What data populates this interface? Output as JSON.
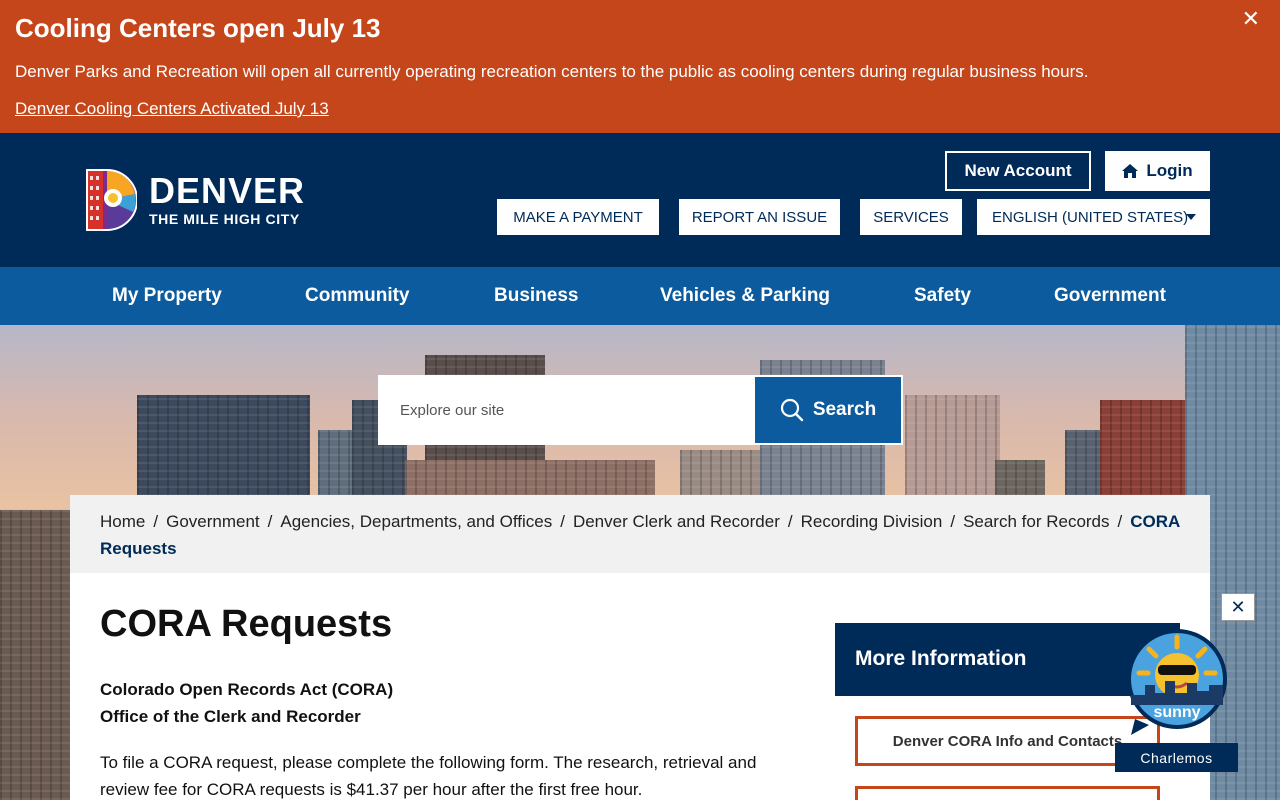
{
  "alert": {
    "title": "Cooling Centers open July 13",
    "text": "Denver Parks and Recreation will open all currently operating recreation centers to the public as cooling centers during regular business hours.",
    "link": "Denver Cooling Centers Activated July 13",
    "close": "✕"
  },
  "header": {
    "logo_big": "DENVER",
    "logo_small": "THE MILE HIGH CITY",
    "new_account": "New Account",
    "login": "Login",
    "utility": {
      "payment": "MAKE A PAYMENT",
      "report": "REPORT AN ISSUE",
      "services": "SERVICES",
      "language": "ENGLISH (UNITED STATES)"
    }
  },
  "nav": [
    "My Property",
    "Community",
    "Business",
    "Vehicles & Parking",
    "Safety",
    "Government"
  ],
  "search": {
    "placeholder": "Explore our site",
    "button": "Search"
  },
  "breadcrumb": {
    "items": [
      "Home",
      "Government",
      "Agencies, Departments, and Offices",
      "Denver Clerk and Recorder",
      "Recording Division",
      "Search for Records"
    ],
    "current": "CORA Requests",
    "separator": "/"
  },
  "content": {
    "title": "CORA Requests",
    "subhead_1": "Colorado Open Records Act (CORA)",
    "subhead_2": "Office of the Clerk and Recorder",
    "paragraph": "To file a CORA request, please complete the following form. The research, retrieval and review fee for CORA requests is $41.37 per hour after the first free hour."
  },
  "sidebar": {
    "heading": "More Information",
    "link_1": "Denver CORA Info and Contacts"
  },
  "chat": {
    "close": "✕",
    "bot_name": "sunny",
    "label": "Charlemos"
  },
  "colors": {
    "alert": "#c5461a",
    "header": "#002a57",
    "nav": "#0c5b9e"
  }
}
